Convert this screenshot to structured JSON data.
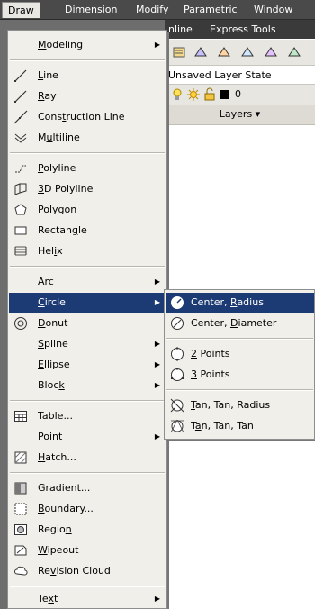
{
  "menubar": {
    "items": [
      {
        "label": "Draw"
      },
      {
        "label": "Dimension"
      },
      {
        "label": "Modify"
      },
      {
        "label": "Parametric"
      },
      {
        "label": "Window"
      }
    ]
  },
  "ribbon": {
    "tabs": [
      {
        "label": "nline"
      },
      {
        "label": "Express Tools"
      }
    ],
    "layer_state": "Unsaved Layer State",
    "layer_value": "0",
    "layers_label": "Layers ▾"
  },
  "draw_menu": {
    "items": [
      {
        "pre": "",
        "key": "M",
        "post": "odeling",
        "arrow": true
      },
      {
        "pre": "",
        "key": "L",
        "post": "ine"
      },
      {
        "pre": "",
        "key": "R",
        "post": "ay"
      },
      {
        "pre": "Cons",
        "key": "t",
        "post": "ruction Line"
      },
      {
        "pre": "M",
        "key": "u",
        "post": "ltiline"
      },
      {
        "pre": "",
        "key": "P",
        "post": "olyline"
      },
      {
        "pre": "",
        "key": "3",
        "post": "D Polyline"
      },
      {
        "pre": "Pol",
        "key": "y",
        "post": "gon"
      },
      {
        "pre": "Rectan",
        "key": "g",
        "post": "le"
      },
      {
        "pre": "Hel",
        "key": "i",
        "post": "x"
      },
      {
        "pre": "",
        "key": "A",
        "post": "rc",
        "arrow": true
      },
      {
        "pre": "",
        "key": "C",
        "post": "ircle",
        "arrow": true
      },
      {
        "pre": "",
        "key": "D",
        "post": "onut"
      },
      {
        "pre": "",
        "key": "S",
        "post": "pline",
        "arrow": true
      },
      {
        "pre": "",
        "key": "E",
        "post": "llipse",
        "arrow": true
      },
      {
        "pre": "Bloc",
        "key": "k",
        "post": "",
        "arrow": true
      },
      {
        "pre": "Table...",
        "key": "",
        "post": ""
      },
      {
        "pre": "P",
        "key": "o",
        "post": "int",
        "arrow": true
      },
      {
        "pre": "",
        "key": "H",
        "post": "atch..."
      },
      {
        "pre": "Gradient...",
        "key": "",
        "post": ""
      },
      {
        "pre": "",
        "key": "B",
        "post": "oundary..."
      },
      {
        "pre": "Regio",
        "key": "n",
        "post": ""
      },
      {
        "pre": "",
        "key": "W",
        "post": "ipeout"
      },
      {
        "pre": "Re",
        "key": "v",
        "post": "ision Cloud"
      },
      {
        "pre": "Te",
        "key": "x",
        "post": "t",
        "arrow": true
      }
    ]
  },
  "circle_submenu": {
    "items": [
      {
        "pre": "Center, ",
        "key": "R",
        "post": "adius"
      },
      {
        "pre": "Center, ",
        "key": "D",
        "post": "iameter"
      },
      {
        "pre": "",
        "key": "2",
        "post": " Points"
      },
      {
        "pre": "",
        "key": "3",
        "post": " Points"
      },
      {
        "pre": "",
        "key": "T",
        "post": "an, Tan, Radius"
      },
      {
        "pre": "T",
        "key": "a",
        "post": "n, Tan, Tan"
      }
    ]
  },
  "colors": {
    "highlight": "#1c3a73",
    "menu_bg": "#f1efe9",
    "menubar_bg": "#4a4a4a"
  }
}
